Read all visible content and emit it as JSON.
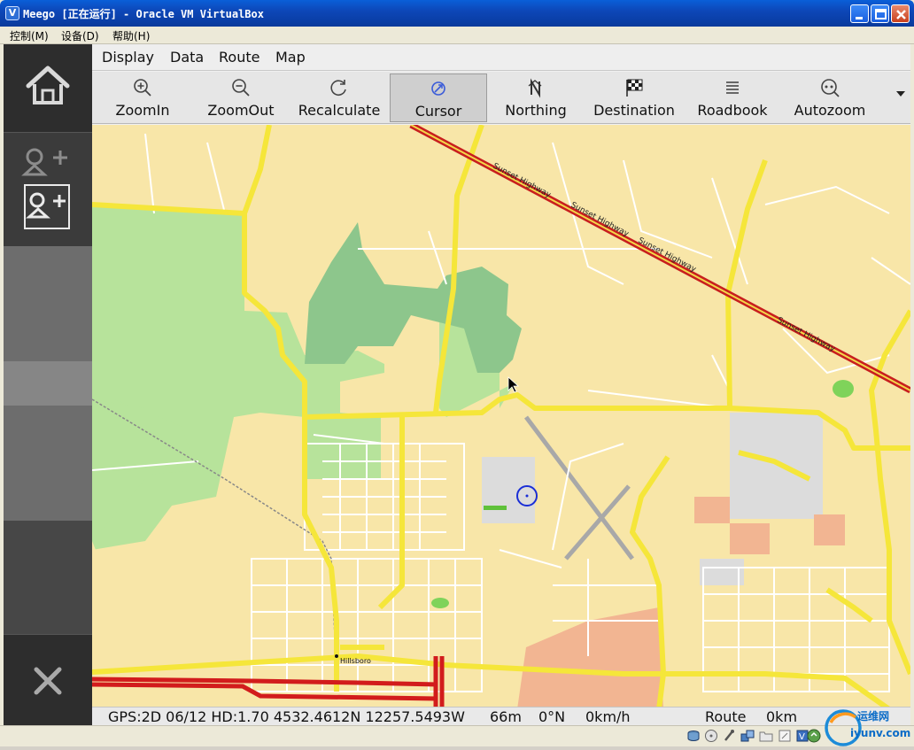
{
  "window": {
    "title": "Meego [正在运行] - Oracle VM VirtualBox",
    "icon": "virtualbox-icon"
  },
  "host_menu": {
    "items": [
      "控制(M)",
      "设备(D)",
      "帮助(H)"
    ]
  },
  "sidebar": {
    "home_icon": "home-icon",
    "contacts_icon": "add-contact-icon",
    "close_icon": "close-icon"
  },
  "app_menu": {
    "items": [
      "Display",
      "Data",
      "Route",
      "Map"
    ]
  },
  "toolbar": {
    "tools": [
      {
        "label": "ZoomIn",
        "icon": "zoom-in-icon"
      },
      {
        "label": "ZoomOut",
        "icon": "zoom-out-icon"
      },
      {
        "label": "Recalculate",
        "icon": "refresh-icon"
      },
      {
        "label": "Cursor",
        "icon": "cursor-icon",
        "active": true
      },
      {
        "label": "Northing",
        "icon": "north-icon"
      },
      {
        "label": "Destination",
        "icon": "checkered-flag-icon"
      },
      {
        "label": "Roadbook",
        "icon": "list-icon"
      },
      {
        "label": "Autozoom",
        "icon": "autozoom-icon"
      }
    ]
  },
  "map": {
    "road_labels": [
      "Sunset Highway",
      "Sunset Highway",
      "Sunset Highway",
      "Sunset Highway"
    ],
    "place_label": "Hillsboro",
    "colors": {
      "background": "#f8e6a8",
      "main_road": "#f5e63a",
      "highway": "#e02020",
      "forest": "#b6e39a",
      "dark_forest": "#8bc48b",
      "residential": "#f0b693",
      "airport": "#dcdcdc"
    }
  },
  "status": {
    "gps": "GPS:2D 06/12 HD:1.70 4532.4612N 12257.5493W",
    "altitude": "66m",
    "heading": "0°N",
    "speed": "0km/h",
    "route_label": "Route",
    "route_distance": "0km"
  },
  "watermark": {
    "brand": "运维网",
    "url": "iyunv.com"
  }
}
